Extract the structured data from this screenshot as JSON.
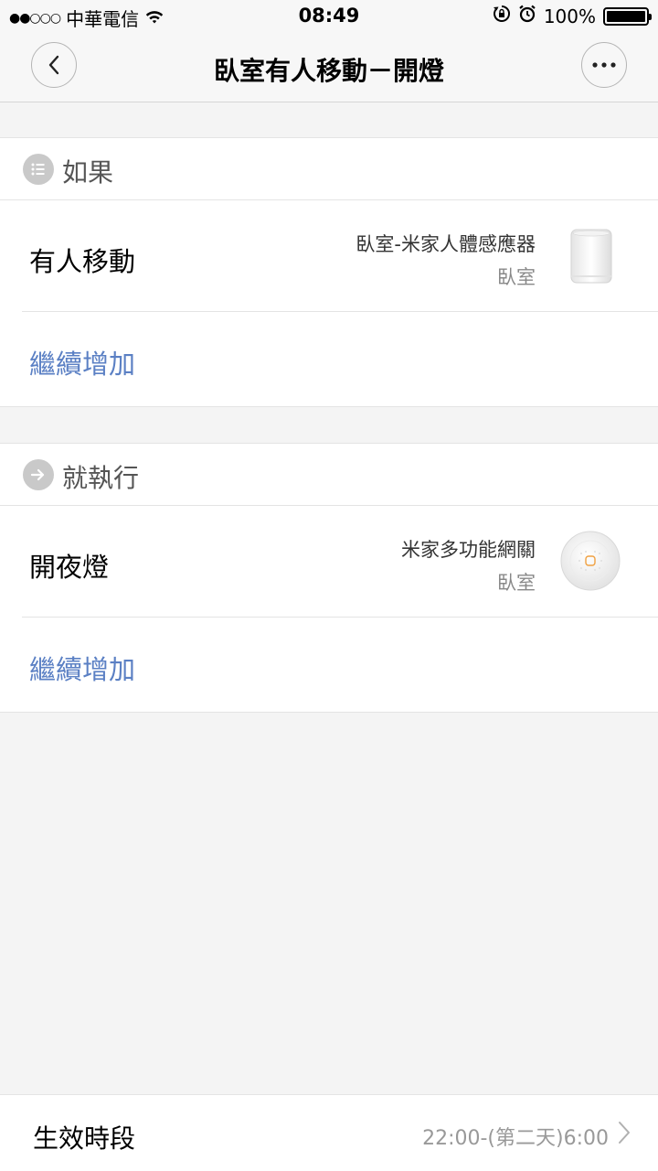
{
  "status_bar": {
    "signal_dots": "●●○○○",
    "carrier": "中華電信",
    "time": "08:49",
    "battery": "100%",
    "battery_level": 1.0
  },
  "nav": {
    "title": "臥室有人移動－開燈"
  },
  "if_section": {
    "header": "如果",
    "condition": {
      "title": "有人移動",
      "device": "臥室-米家人體感應器",
      "room": "臥室"
    },
    "add_label": "繼續增加"
  },
  "then_section": {
    "header": "就執行",
    "action": {
      "title": "開夜燈",
      "device": "米家多功能網關",
      "room": "臥室"
    },
    "add_label": "繼續增加"
  },
  "effective_period": {
    "label": "生效時段",
    "value": "22:00-(第二天)6:00"
  },
  "colors": {
    "accent_link": "#5b80c4",
    "background": "#f4f4f4",
    "icon_gray": "#c9c9c9"
  }
}
